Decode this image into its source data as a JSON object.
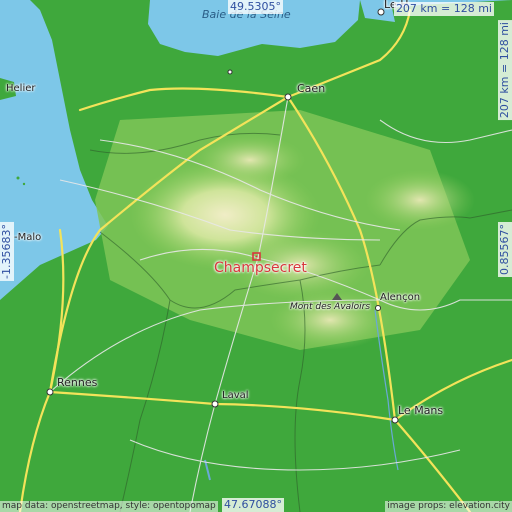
{
  "map": {
    "place": "Champsecret",
    "coordinates": {
      "north": "49.5305°",
      "south": "47.67088°",
      "west": "-1.35683°",
      "east": "0.85567°"
    },
    "scale": {
      "horizontal": "207 km = 128 mi",
      "vertical": "207 km = 128 mi"
    },
    "sea_label": "Baie de la Seine",
    "peak_label": "Mont des Avaloirs",
    "cities": [
      "Caen",
      "Le Havre",
      "Rennes",
      "Laval",
      "Le Mans",
      "Alençon",
      "Saint-Malo",
      "Saint-Helier"
    ],
    "city_label_text": {
      "caen": "Caen",
      "le_havre_partial": "Le H",
      "rennes": "Rennes",
      "laval": "Laval",
      "le_mans": "Le Mans",
      "alencon": "Alençon",
      "saint_malo_partial": "-Malo",
      "saint_helier_partial": "Helier"
    },
    "credits": {
      "left": "map data: openstreetmap, style: opentopomap",
      "right": "image props: elevation.city"
    },
    "colors": {
      "sea": "#7dc7e8",
      "lowland": "#3aa63a",
      "midland": "#8fce5c",
      "upland": "#e6e8b4",
      "marker": "#d8373c",
      "coord_text": "#2f4fa0"
    }
  }
}
